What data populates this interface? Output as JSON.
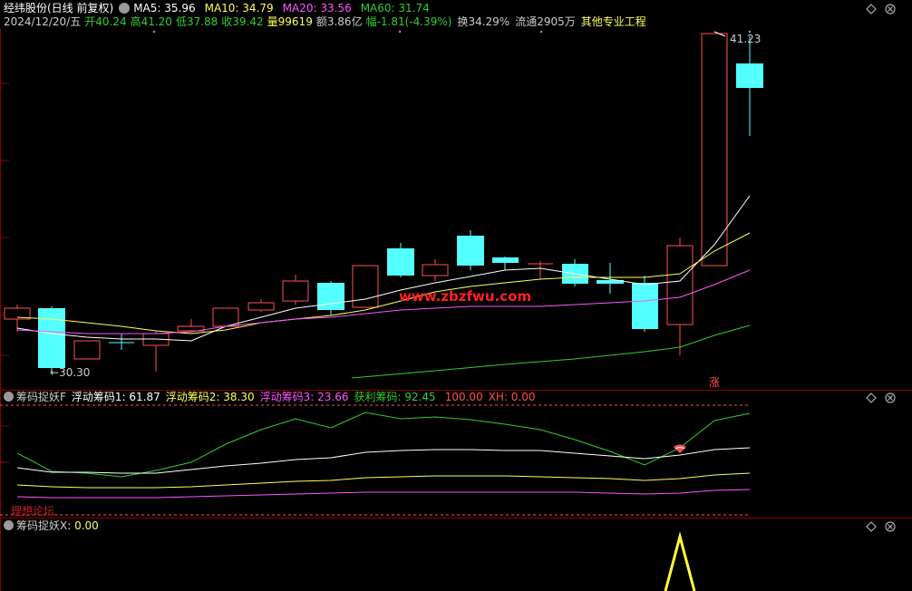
{
  "header": {
    "stock_title": "经纬股份(日线 前复权)",
    "ma5": "MA5: 35.96",
    "ma10": "MA10: 34.79",
    "ma20": "MA20: 33.56",
    "ma60": "MA60: 31.74",
    "date": "2024/12/20/五",
    "open": "开40.24",
    "high": "高41.20",
    "low": "低37.88",
    "close": "收39.42",
    "volume": "量99619",
    "amount": "额3.86亿",
    "change": "幅-1.81(-4.39%)",
    "turnover": "换34.29%",
    "float": "流通2905万",
    "industry": "其他专业工程"
  },
  "main_chart": {
    "high_label": "41.23",
    "low_label": "←30.30",
    "watermark": "www.zbzfwu.com",
    "limit_up_mark": "涨"
  },
  "panel2": {
    "title": "筹码捉妖F",
    "line1": "浮动筹码1: 61.87",
    "line2": "浮动筹码2: 38.30",
    "line3": "浮动筹码3: 23.66",
    "line4": "获利筹码: 92.45",
    "line5": "100.00",
    "line6": "XH: 0.00",
    "forum_label": "理想论坛"
  },
  "panel3": {
    "title": "筹码捉妖X",
    "value": ": 0.00"
  },
  "colors": {
    "up": "#ff5050",
    "down": "#54ffff",
    "ma5": "#ffffff",
    "ma10": "#ffff55",
    "ma20": "#ff55ff",
    "ma60": "#33cc33",
    "grid": "#8b0000"
  }
}
